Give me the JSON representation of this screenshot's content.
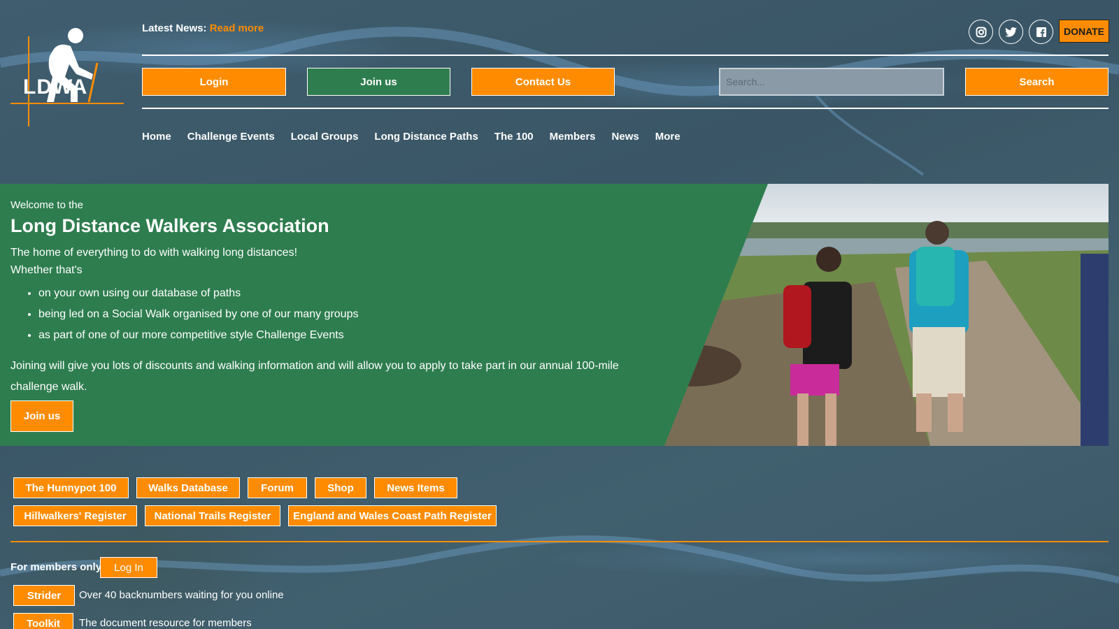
{
  "header": {
    "logo_text": "LDWA",
    "latest_news_label": "Latest News:",
    "read_more": "Read more",
    "social": [
      "instagram-icon",
      "twitter-icon",
      "facebook-icon"
    ],
    "donate": "DONATE",
    "login": "Login",
    "join": "Join us",
    "contact": "Contact Us",
    "search_placeholder": "Search...",
    "search_button": "Search",
    "nav": [
      "Home",
      "Challenge Events",
      "Local Groups",
      "Long Distance Paths",
      "The 100",
      "Members",
      "News",
      "More"
    ]
  },
  "hero": {
    "welcome": "Welcome to the",
    "title": "Long Distance Walkers Association",
    "subtitle_1": "The home of everything to do with walking long distances!",
    "subtitle_2": "Whether that's",
    "bullets": [
      "on your own using our database of paths",
      "being led on a Social Walk organised by one of our many groups",
      "as part of one of our more competitive style Challenge Events"
    ],
    "joining_text": "Joining will give you lots of discounts and walking information and will allow you to apply to take part in our annual 100-mile challenge walk.",
    "join_button": "Join us"
  },
  "quick_links": {
    "row1": [
      "The Hunnypot 100",
      "Walks Database",
      "Forum",
      "Shop",
      "News Items"
    ],
    "row2": [
      "Hillwalkers' Register",
      "National Trails Register",
      "England and Wales Coast Path Register"
    ]
  },
  "members": {
    "label": "For members only:",
    "login": "Log In",
    "resources": [
      {
        "button": "Strider",
        "desc": "Over 40 backnumbers waiting for you online"
      },
      {
        "button": "Toolkit",
        "desc": "The document resource for members"
      }
    ]
  },
  "colors": {
    "accent_orange": "#ff8c00",
    "brand_green": "#2e7d4f",
    "background": "#3d5a6b"
  }
}
